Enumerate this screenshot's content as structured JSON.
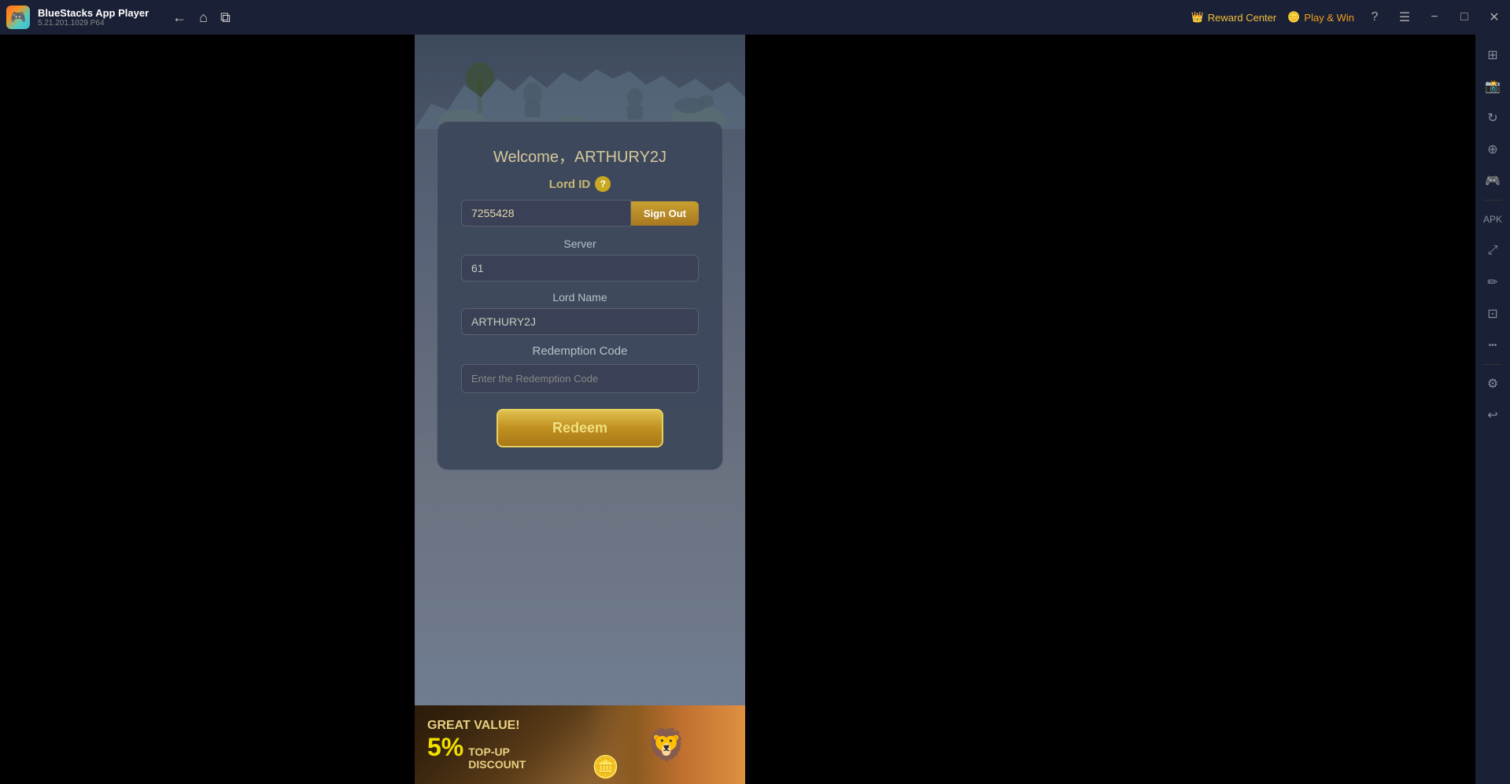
{
  "titlebar": {
    "app_name": "BlueStacks App Player",
    "app_version": "5.21.201.1029  P64",
    "logo_emoji": "🎮",
    "nav": {
      "back_label": "←",
      "home_label": "⌂",
      "multi_label": "⧉"
    },
    "reward_center_label": "Reward Center",
    "reward_center_icon": "👑",
    "play_win_label": "Play & Win",
    "play_win_icon": "🪙",
    "help_icon": "?",
    "menu_icon": "☰",
    "minimize_icon": "−",
    "maximize_icon": "□",
    "close_icon": "✕"
  },
  "dialog": {
    "welcome_text": "Welcome，ARTHURY2J",
    "lord_id_label": "Lord ID",
    "question_mark": "?",
    "lord_id_value": "7255428",
    "sign_out_label": "Sign Out",
    "server_label": "Server",
    "server_value": "61",
    "lord_name_label": "Lord Name",
    "lord_name_value": "ARTHURY2J",
    "redemption_code_label": "Redemption Code",
    "redemption_code_placeholder": "Enter the Redemption Code",
    "redeem_button_label": "Redeem"
  },
  "banner": {
    "great_value_label": "GREAT VALUE!",
    "percent_label": "5%",
    "topup_label": "TOP-UP",
    "discount_label": "DISCOUNT",
    "lion_emoji": "🦁",
    "coin_emoji": "🪙"
  },
  "sidebar_icons": [
    {
      "name": "layout-icon",
      "symbol": "⊞"
    },
    {
      "name": "camera-icon",
      "symbol": "📷"
    },
    {
      "name": "rotate-icon",
      "symbol": "↻"
    },
    {
      "name": "location-icon",
      "symbol": "⊕"
    },
    {
      "name": "controller-icon",
      "symbol": "🎮"
    },
    {
      "name": "apk-icon",
      "symbol": "📦"
    },
    {
      "name": "scale-icon",
      "symbol": "⤢"
    },
    {
      "name": "edit2-icon",
      "symbol": "✏"
    },
    {
      "name": "crop-icon",
      "symbol": "⊡"
    },
    {
      "name": "more-icon",
      "symbol": "•••"
    },
    {
      "name": "settings-icon",
      "symbol": "⚙"
    },
    {
      "name": "back2-icon",
      "symbol": "↩"
    }
  ]
}
